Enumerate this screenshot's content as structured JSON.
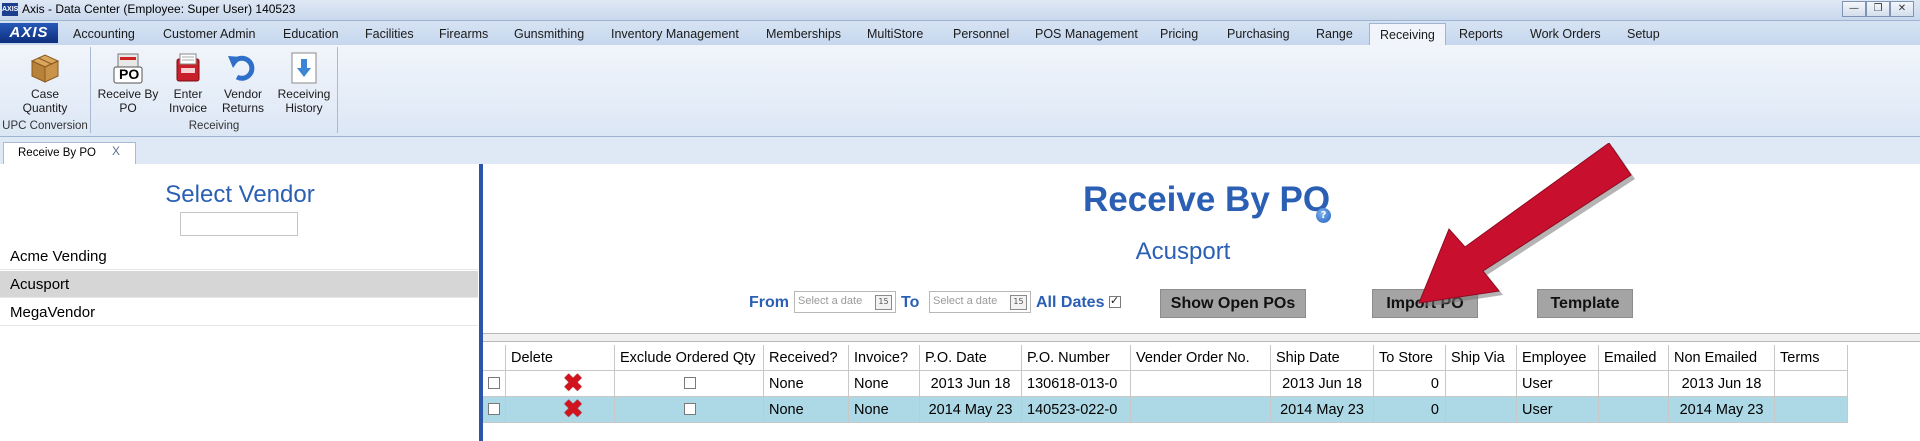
{
  "window": {
    "title": "Axis - Data Center  (Employee: Super User) 140523",
    "app_icon_text": "AXIS"
  },
  "menubar": {
    "logo": "AXIS",
    "tabs": [
      "Accounting",
      "Customer Admin",
      "Education",
      "Facilities",
      "Firearms",
      "Gunsmithing",
      "Inventory Management",
      "Memberships",
      "MultiStore",
      "Personnel",
      "POS Management",
      "Pricing",
      "Purchasing",
      "Range",
      "Receiving",
      "Reports",
      "Work Orders",
      "Setup"
    ],
    "active_tab": "Receiving"
  },
  "ribbon": {
    "groups": [
      {
        "label": "UPC Conversion",
        "buttons": [
          {
            "label": "Case\nQuantity",
            "icon": "box-icon"
          }
        ]
      },
      {
        "label": "Receiving",
        "buttons": [
          {
            "label": "Receive By\nPO",
            "icon": "receive-po-icon",
            "icon_text": "PO"
          },
          {
            "label": "Enter\nInvoice",
            "icon": "invoice-icon"
          },
          {
            "label": "Vendor\nReturns",
            "icon": "return-arrow-icon"
          },
          {
            "label": "Receiving\nHistory",
            "icon": "download-history-icon"
          }
        ]
      }
    ]
  },
  "doc_tabs": [
    {
      "label": "Receive By PO",
      "close": "X"
    }
  ],
  "left_pane": {
    "title": "Select Vendor",
    "search_value": "",
    "vendors": [
      "Acme Vending",
      "Acusport",
      "MegaVendor"
    ],
    "selected_vendor": "Acusport"
  },
  "main": {
    "title": "Receive By PO",
    "help_icon_text": "?",
    "vendor_name": "Acusport",
    "filters": {
      "from_label": "From",
      "to_label": "To",
      "date_placeholder": "Select a date",
      "calendar_icon_text": "15",
      "all_dates_label": "All Dates",
      "all_dates_checked": true
    },
    "buttons": {
      "show_open": "Show Open POs",
      "import": "Import PO",
      "template": "Template"
    },
    "grid": {
      "columns": [
        "",
        "Delete",
        "Exclude Ordered Qty",
        "Received?",
        "Invoice?",
        "P.O. Date",
        "P.O. Number",
        "Vender Order No.",
        "Ship Date",
        "To Store",
        "Ship Via",
        "Employee",
        "Emailed",
        "Non Emailed",
        "Terms"
      ],
      "rows": [
        {
          "received": "None",
          "invoice": "None",
          "po_date": "2013 Jun 18",
          "po_number": "130618-013-0",
          "vender_order_no": "",
          "ship_date": "2013 Jun 18",
          "to_store": "0",
          "ship_via": "",
          "employee": "User",
          "emailed": "",
          "non_emailed": "2013 Jun 18",
          "terms": ""
        },
        {
          "received": "None",
          "invoice": "None",
          "po_date": "2014 May 23",
          "po_number": "140523-022-0",
          "vender_order_no": "",
          "ship_date": "2014 May 23",
          "to_store": "0",
          "ship_via": "",
          "employee": "User",
          "emailed": "",
          "non_emailed": "2014 May 23",
          "terms": ""
        }
      ]
    }
  },
  "colors": {
    "accent_blue": "#2a5fb3",
    "selected_row": "#add8e6",
    "annotation_arrow": "#c8102e",
    "delete_icon": "#d1131e"
  }
}
